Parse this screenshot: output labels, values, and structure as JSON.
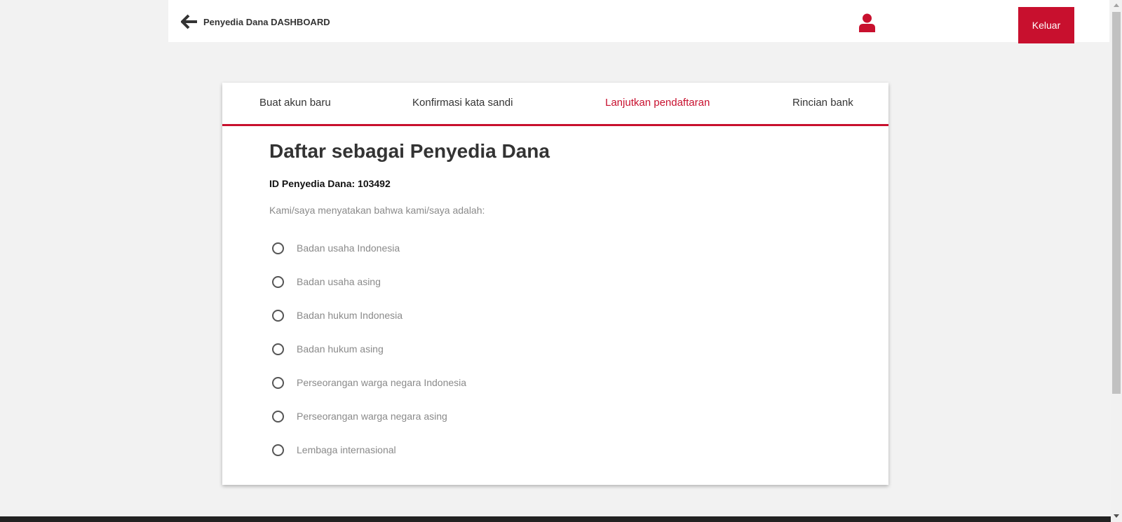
{
  "header": {
    "title": "Penyedia Dana DASHBOARD",
    "logout_label": "Keluar",
    "accent_color": "#c8102e"
  },
  "tabs": [
    {
      "label": "Buat akun baru",
      "active": false
    },
    {
      "label": "Konfirmasi kata sandi",
      "active": false
    },
    {
      "label": "Lanjutkan pendaftaran",
      "active": true
    },
    {
      "label": "Rincian bank",
      "active": false
    }
  ],
  "form": {
    "title": "Daftar sebagai Penyedia Dana",
    "provider_id": "ID Penyedia Dana: 103492",
    "intro": "Kami/saya menyatakan bahwa kami/saya adalah:",
    "options": [
      {
        "label": "Badan usaha Indonesia",
        "selected": false
      },
      {
        "label": "Badan usaha asing",
        "selected": false
      },
      {
        "label": "Badan hukum Indonesia",
        "selected": false
      },
      {
        "label": "Badan hukum asing",
        "selected": false
      },
      {
        "label": "Perseorangan warga negara Indonesia",
        "selected": false
      },
      {
        "label": "Perseorangan warga negara asing",
        "selected": false
      },
      {
        "label": "Lembaga internasional",
        "selected": false
      }
    ]
  },
  "icons": {
    "back": "arrow-left-icon",
    "user": "user-icon"
  }
}
